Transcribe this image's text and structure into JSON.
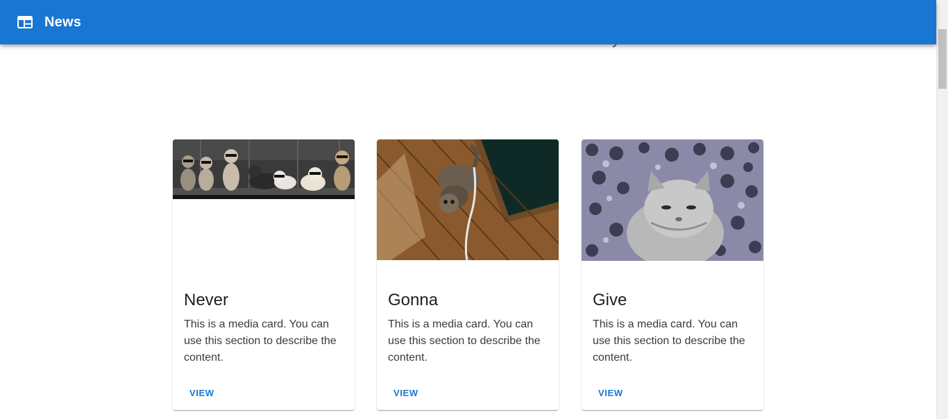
{
  "appbar": {
    "title": "News",
    "icon": "newspaper-layout-icon",
    "color": "#1976d2"
  },
  "page": {
    "subtitle": "Some of the latest news articles for today"
  },
  "cards": [
    {
      "title": "Never",
      "text": "This is a media card. You can use this section to describe the content.",
      "action": "VIEW",
      "image": "cats-wearing-sunglasses-row"
    },
    {
      "title": "Gonna",
      "text": "This is a media card. You can use this section to describe the content.",
      "action": "VIEW",
      "image": "cat-on-wooden-floor"
    },
    {
      "title": "Give",
      "text": "This is a media card. You can use this section to describe the content.",
      "action": "VIEW",
      "image": "fluffy-cat-on-patterned-background"
    }
  ]
}
